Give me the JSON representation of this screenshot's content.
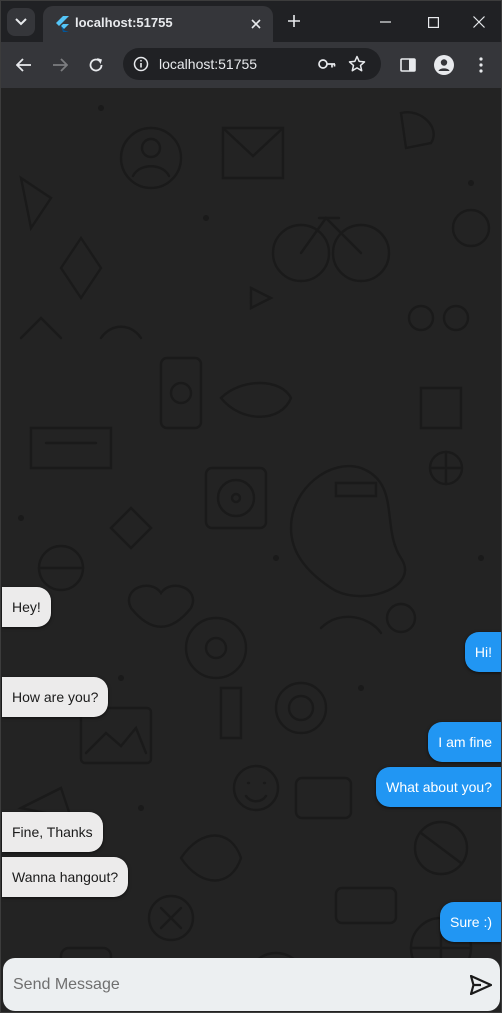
{
  "browser": {
    "tab_title": "localhost:51755",
    "address": "localhost:51755"
  },
  "chat": {
    "messages": [
      {
        "from": "them",
        "text": "Hey!"
      },
      {
        "from": "me",
        "text": "Hi!"
      },
      {
        "from": "them",
        "text": "How are you?"
      },
      {
        "from": "me",
        "text": "I am fine"
      },
      {
        "from": "me",
        "text": "What about you?"
      },
      {
        "from": "them",
        "text": "Fine, Thanks"
      },
      {
        "from": "them",
        "text": "Wanna hangout?"
      },
      {
        "from": "me",
        "text": "Sure :)"
      }
    ],
    "incoming_color": "#ecebeb",
    "outgoing_color": "#2196f3",
    "background_color": "#232323"
  },
  "composer": {
    "placeholder": "Send Message",
    "value": ""
  },
  "icons": {
    "tab_search": "chevron-down-icon",
    "favicon": "flutter-icon",
    "close": "close-icon",
    "new_tab": "plus-icon",
    "back": "back-arrow-icon",
    "forward": "forward-arrow-icon",
    "reload": "reload-icon",
    "site_info": "info-icon",
    "passwords": "key-icon",
    "bookmark": "star-icon",
    "side_panel": "side-panel-icon",
    "profile": "profile-icon",
    "menu": "kebab-menu-icon",
    "send": "send-icon"
  }
}
